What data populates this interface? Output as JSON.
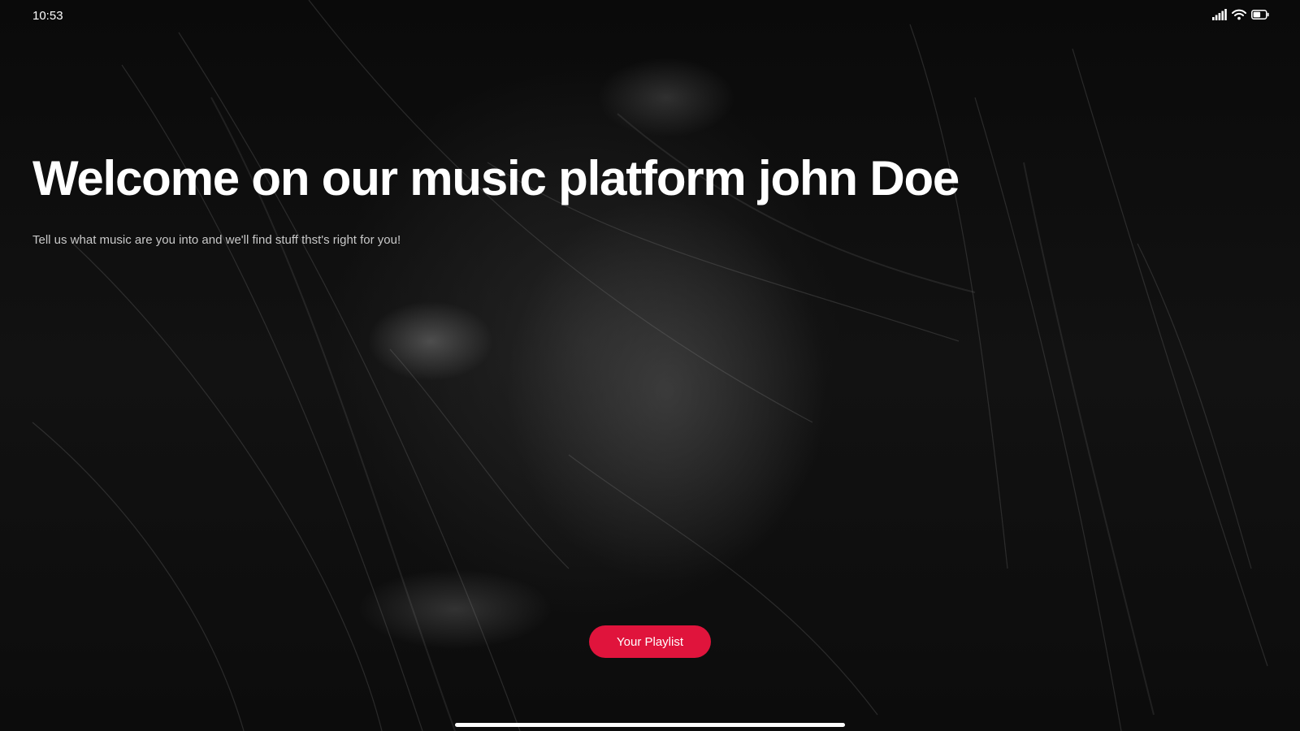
{
  "status_bar": {
    "time": "10:53",
    "icons": [
      "cellular-signal-icon",
      "wifi-icon",
      "battery-icon"
    ]
  },
  "hero": {
    "title": "Welcome on our music platform john Doe",
    "subtitle": "Tell us what music are you into and we'll find stuff thst's right for you!"
  },
  "cta": {
    "label": "Your Playlist"
  },
  "colors": {
    "accent": "#e0143c",
    "background": "#0b0b0b",
    "text": "#ffffff",
    "subtitle_text": "#c9c9c9"
  }
}
